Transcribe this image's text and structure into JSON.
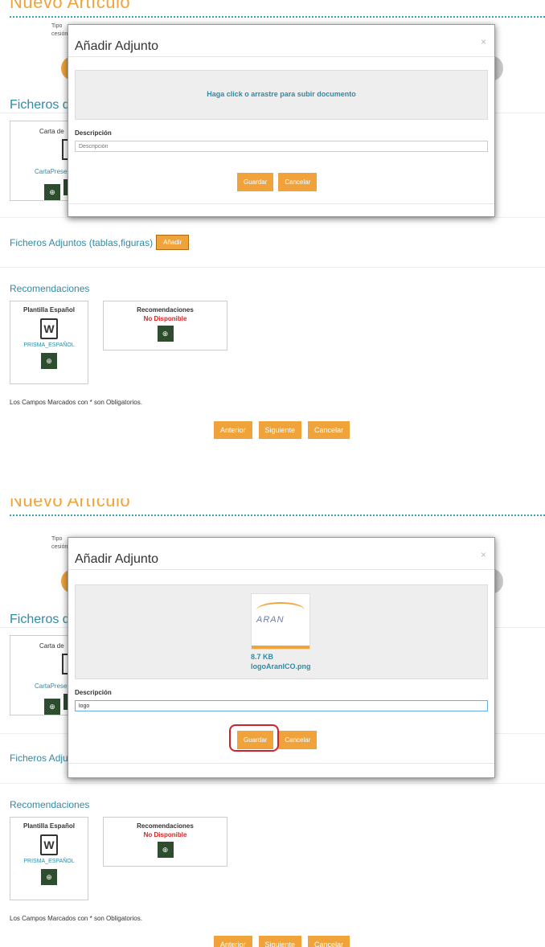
{
  "page": {
    "title": "Nuevo Artículo",
    "tipo_fragment": "Tipo cesión",
    "ficheros_fragment": "Ficheros d",
    "card_fragment_title": "Carta de",
    "card_fragment_link": "CartaPrese",
    "adjuntos_label": "Ficheros Adjuntos (tablas,figuras)",
    "adjuntos_label_short": "Ficheros Adjun",
    "add_button": "Añadir",
    "recomendaciones_title": "Recomendaciones",
    "plantilla": {
      "title": "Plantilla Español",
      "icon": "W",
      "link": "PRISMA_ESPAÑOL"
    },
    "recomendaciones_box": {
      "title": "Recomendaciones",
      "status": "No Disponible"
    },
    "obligatorios_note": "Los Campos Marcados con * son Obligatorios.",
    "nav": {
      "prev": "Anterior",
      "next": "Siguiente",
      "cancel": "Cancelar"
    }
  },
  "modal1": {
    "title": "Añadir Adjunto",
    "close": "×",
    "dropzone_text": "Haga click o arrastre para subir documento",
    "description_label": "Descripción",
    "description_placeholder": "Descripción",
    "description_value": "",
    "save": "Guardar",
    "cancel": "Cancelar"
  },
  "modal2": {
    "title": "Añadir Adjunto",
    "close": "×",
    "file": {
      "thumb_text": "ARAN",
      "size": "8.7 KB",
      "name": "logoAranICO.png"
    },
    "description_label": "Descripción",
    "description_placeholder": "Descripción",
    "description_value": "logo",
    "save": "Guardar",
    "cancel": "Cancelar"
  },
  "colors": {
    "accent": "#f0a33a",
    "link": "#2f8aa6",
    "dark_green": "#2e4d2e",
    "error": "#e02020",
    "highlight": "#d0202a"
  }
}
